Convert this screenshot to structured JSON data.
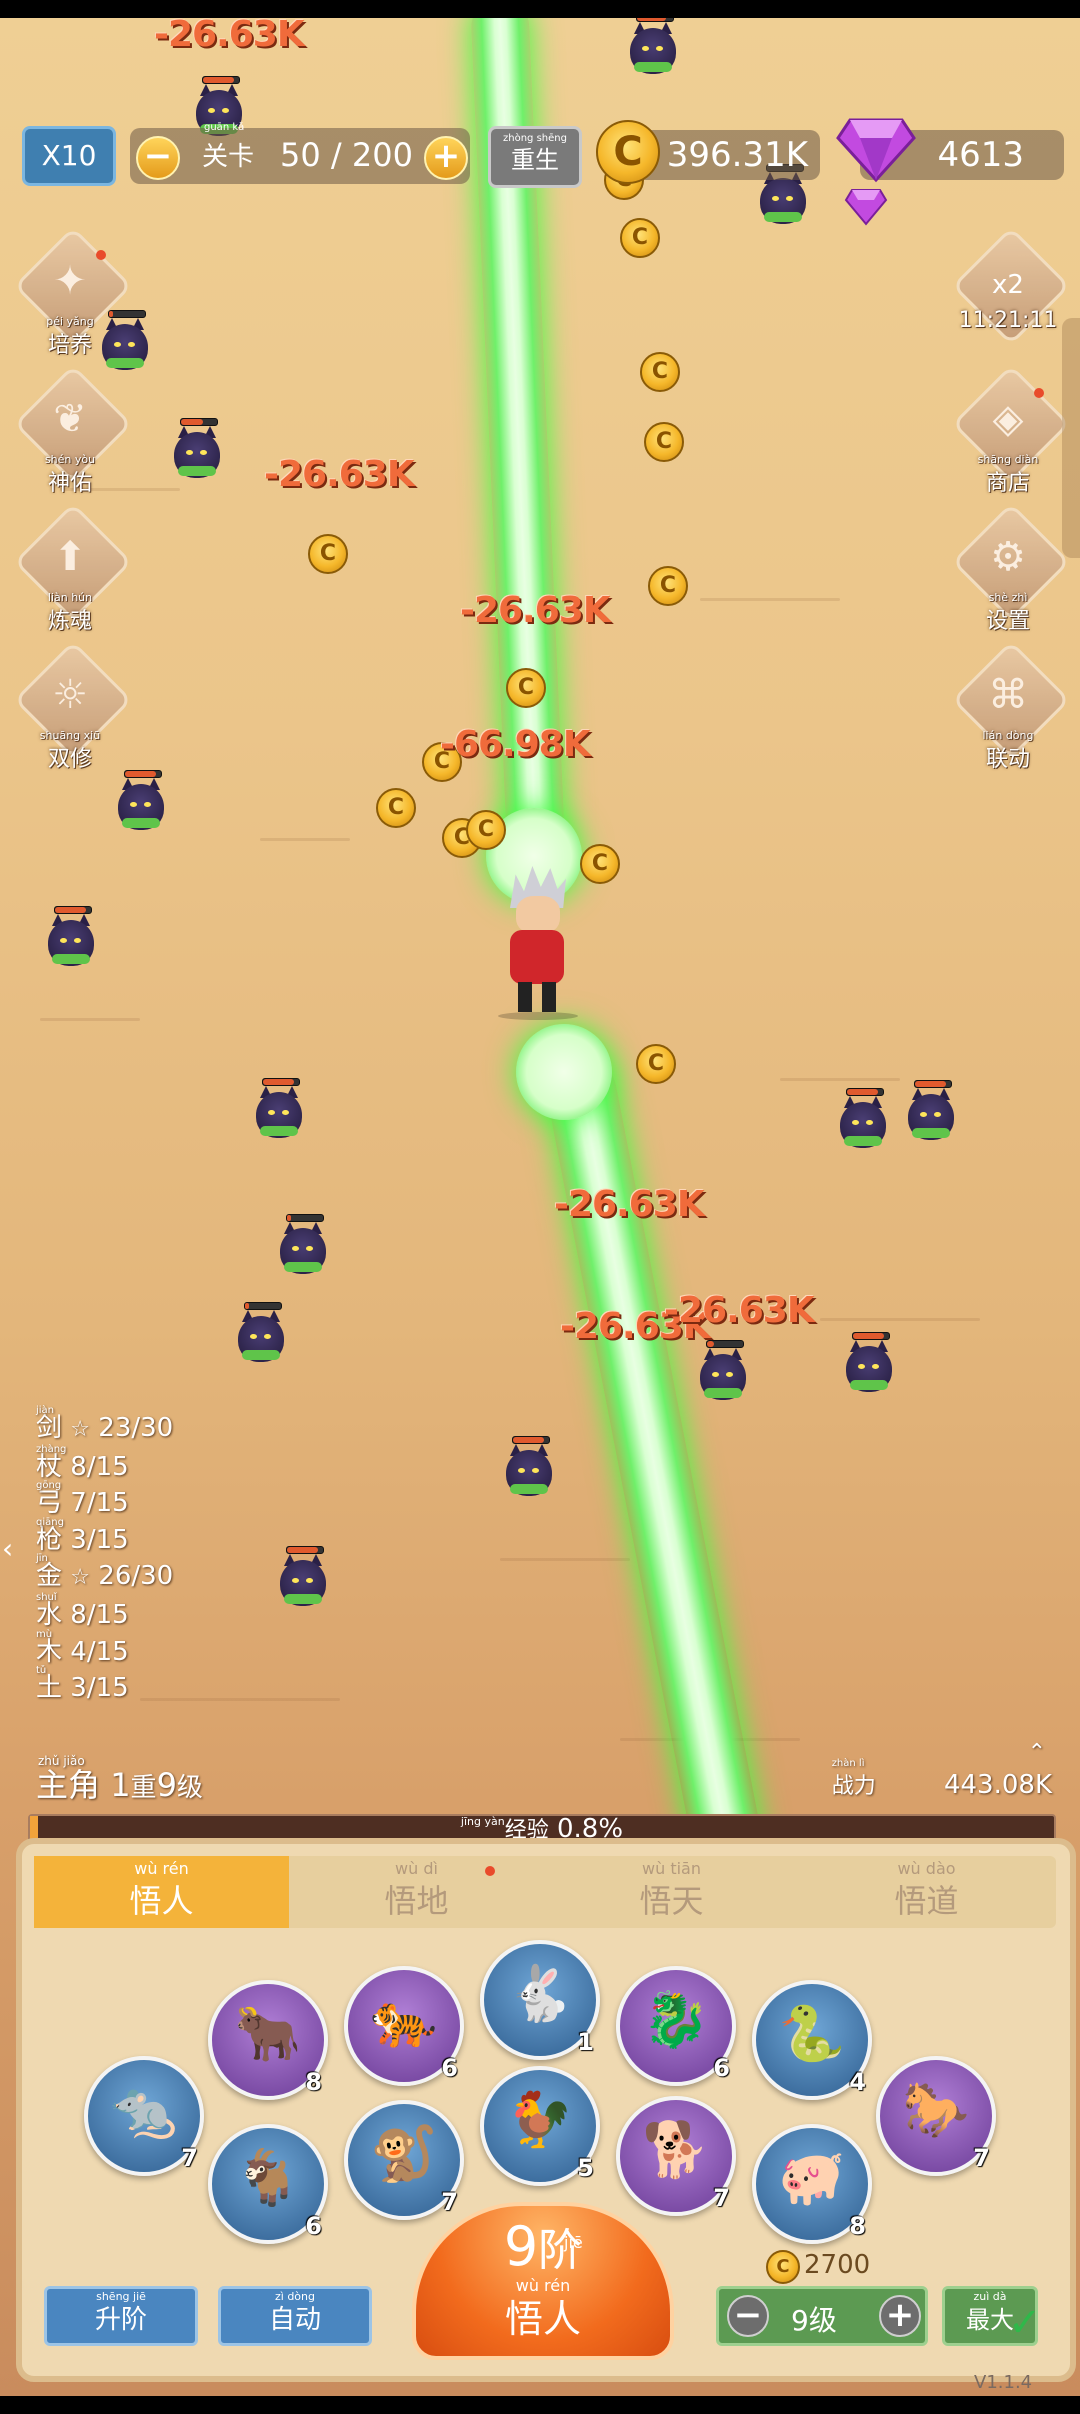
{
  "hud": {
    "multiplier": "X10",
    "stage_label": "关卡",
    "stage_pinyin": "guān  kǎ",
    "stage_value": "50 / 200",
    "rebirth_label": "重生",
    "rebirth_pinyin": "zhòng shēng",
    "gold": "396.31K",
    "gems": "4613"
  },
  "left_menu": [
    {
      "label": "培养",
      "pinyin": "péi yǎng",
      "icon": "cultivate-icon"
    },
    {
      "label": "神佑",
      "pinyin": "shén yòu",
      "icon": "bless-icon"
    },
    {
      "label": "炼魂",
      "pinyin": "liàn hún",
      "icon": "soul-refine-icon"
    },
    {
      "label": "双修",
      "pinyin": "shuāng xiū",
      "icon": "dual-cultivate-icon"
    }
  ],
  "right_menu": [
    {
      "label": "x2",
      "sub": "11:21:11",
      "icon": "double-bag-icon"
    },
    {
      "label": "商店",
      "pinyin": "shāng diàn",
      "icon": "shop-icon"
    },
    {
      "label": "设置",
      "pinyin": "shè zhì",
      "icon": "gear-icon"
    },
    {
      "label": "联动",
      "pinyin": "lián dòng",
      "icon": "collab-icon"
    }
  ],
  "damage_numbers": [
    "-26.63K",
    "-26.63K",
    "-26.63K",
    "-66.98K",
    "-26.63K",
    "-26.63K",
    "-26.63K"
  ],
  "stats": [
    {
      "name": "剑",
      "pinyin": "jiàn",
      "star": true,
      "value": "23/30"
    },
    {
      "name": "杖",
      "pinyin": "zhàng",
      "star": false,
      "value": "8/15"
    },
    {
      "name": "弓",
      "pinyin": "gōng",
      "star": false,
      "value": "7/15"
    },
    {
      "name": "枪",
      "pinyin": "qiāng",
      "star": false,
      "value": "3/15"
    },
    {
      "name": "金",
      "pinyin": "jīn",
      "star": true,
      "value": "26/30"
    },
    {
      "name": "水",
      "pinyin": "shuǐ",
      "star": false,
      "value": "8/15"
    },
    {
      "name": "木",
      "pinyin": "mù",
      "star": false,
      "value": "4/15"
    },
    {
      "name": "土",
      "pinyin": "tǔ",
      "star": false,
      "value": "3/15"
    }
  ],
  "player": {
    "label": "主角",
    "pinyin": "zhǔ jiǎo",
    "rebirth_count": "1",
    "rebirth_unit": "重",
    "level": "9",
    "level_unit": "级",
    "power_label": "战力",
    "power_pinyin": "zhàn lì",
    "power": "443.08K",
    "xp_label": "经验",
    "xp_pinyin": "jīng yàn",
    "xp_percent": "0.8%",
    "xp_fraction": 0.008
  },
  "tabs": [
    {
      "label": "悟人",
      "pinyin": "wù rén",
      "active": true
    },
    {
      "label": "悟地",
      "pinyin": "wù dì",
      "active": false
    },
    {
      "label": "悟天",
      "pinyin": "wù tiān",
      "active": false
    },
    {
      "label": "悟道",
      "pinyin": "wù dào",
      "active": false
    }
  ],
  "zodiac": [
    {
      "name": "rat",
      "glyph": "🐀",
      "level": "7",
      "color": "blue"
    },
    {
      "name": "ox",
      "glyph": "🐂",
      "level": "8",
      "color": "purple"
    },
    {
      "name": "tiger",
      "glyph": "🐅",
      "level": "6",
      "color": "purple"
    },
    {
      "name": "rabbit",
      "glyph": "🐇",
      "level": "1",
      "color": "blue"
    },
    {
      "name": "dragon",
      "glyph": "🐉",
      "level": "6",
      "color": "purple"
    },
    {
      "name": "snake",
      "glyph": "🐍",
      "level": "4",
      "color": "blue"
    },
    {
      "name": "horse",
      "glyph": "🐎",
      "level": "7",
      "color": "purple"
    },
    {
      "name": "goat",
      "glyph": "🐐",
      "level": "6",
      "color": "blue"
    },
    {
      "name": "monkey",
      "glyph": "🐒",
      "level": "7",
      "color": "blue"
    },
    {
      "name": "rooster",
      "glyph": "🐓",
      "level": "5",
      "color": "blue"
    },
    {
      "name": "dog",
      "glyph": "🐕",
      "level": "7",
      "color": "purple"
    },
    {
      "name": "pig",
      "glyph": "🐖",
      "level": "8",
      "color": "blue"
    }
  ],
  "main_button": {
    "tier": "9",
    "tier_unit": "阶",
    "tier_pinyin": "jiē",
    "name": "悟人",
    "name_pinyin": "wù rén"
  },
  "controls": {
    "upgrade_label": "升阶",
    "upgrade_pinyin": "shēng jiē",
    "auto_label": "自动",
    "auto_pinyin": "zì dòng",
    "cost": "2700",
    "level_value": "9级",
    "level_pinyin": "jí",
    "max_label": "最大",
    "max_pinyin": "zuì dà"
  },
  "version": "V1.1.4",
  "colors": {
    "accent": "#f4b33a",
    "beam": "#6ff06a",
    "damage": "#f06b3b"
  }
}
